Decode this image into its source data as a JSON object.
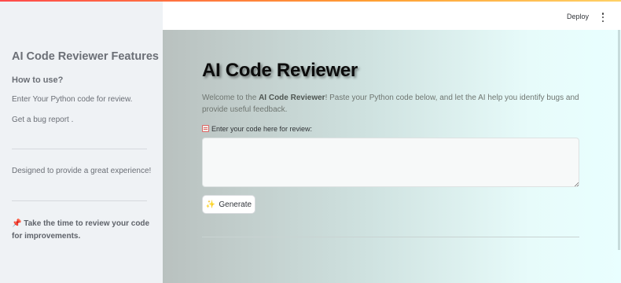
{
  "sidebar": {
    "title": "AI Code Reviewer Features",
    "how_to_heading": "How to use?",
    "step_1": "Enter Your Python code for review.",
    "step_2": "Get a bug report .",
    "experience": "Designed to provide a great experience!",
    "tip_icon": "pushpin-icon",
    "tip": "Take the time to review your code for improvements."
  },
  "header": {
    "deploy_label": "Deploy",
    "menu_icon": "kebab-menu-icon"
  },
  "main": {
    "title": "AI Code Reviewer",
    "welcome_prefix": "Welcome to the ",
    "welcome_bold": "AI Code Reviewer",
    "welcome_suffix": "! Paste your Python code below, and let the AI help you identify bugs and provide useful feedback.",
    "input_icon": "memo-icon",
    "input_label": "Enter your code here for review:",
    "input_value": "",
    "generate_icon": "sparkles-icon",
    "generate_label": "Generate"
  },
  "colors": {
    "sidebar_bg": "#eff2f5",
    "gradient_start": "#b9c1bf",
    "gradient_end": "#e9ffff",
    "accent_line": "#ff4b4b"
  }
}
